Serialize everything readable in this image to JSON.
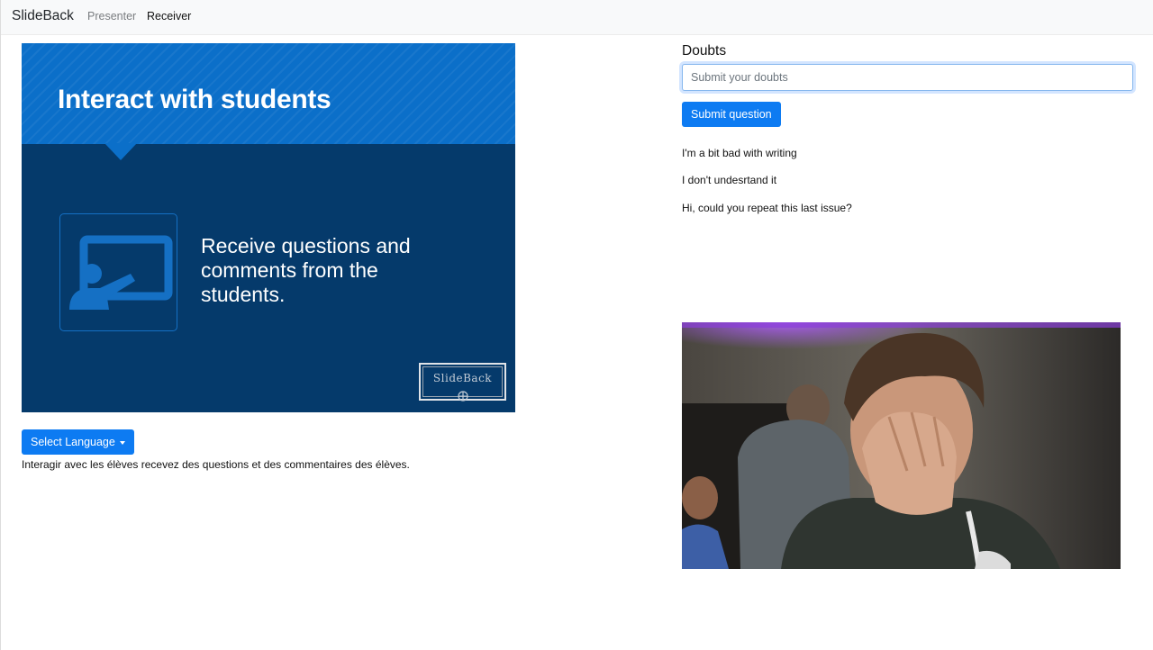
{
  "navbar": {
    "brand": "SlideBack",
    "links": [
      "Presenter",
      "Receiver"
    ]
  },
  "slide": {
    "title": "Interact with students",
    "body": "Receive questions and\ncomments from the\nstudents.",
    "logo_text": "SlideBack",
    "icon": "presenter-board-icon"
  },
  "language": {
    "button_label": "Select Language",
    "translation": "Interagir avec les élèves recevez des questions et des commentaires des élèves."
  },
  "doubts": {
    "title": "Doubts",
    "input_placeholder": "Submit your doubts",
    "input_value": "",
    "submit_label": "Submit question",
    "items": [
      "I'm a bit bad with writing",
      "I don't undesrtand it",
      "Hi, could you repeat this last issue?"
    ]
  },
  "webcam": {
    "content": "webcam-feed"
  },
  "colors": {
    "primary": "#0d7bf2",
    "slide_dark": "#053a6b",
    "slide_banner": "#0b6fc9",
    "navbar_bg": "#f8f9fa"
  }
}
